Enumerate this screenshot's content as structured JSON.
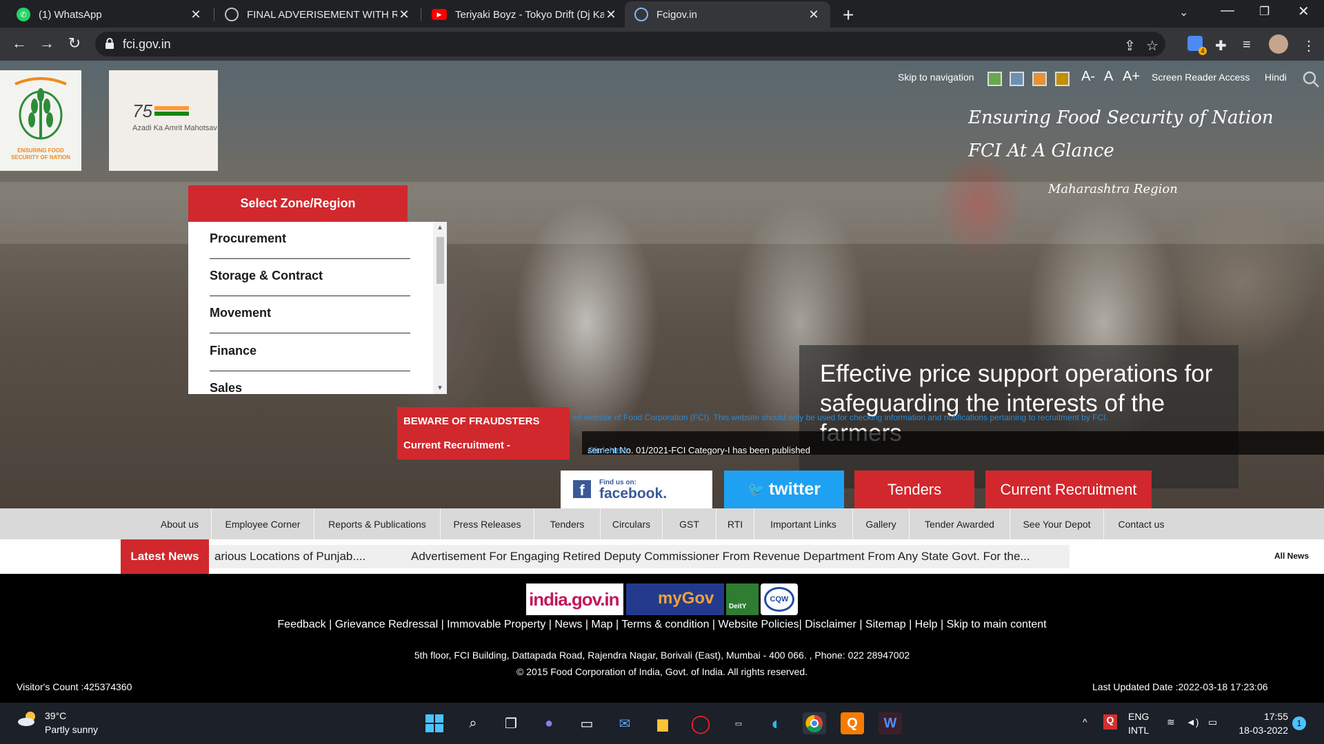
{
  "browser": {
    "tabs": [
      {
        "label": "(1) WhatsApp",
        "icon": "whatsapp-icon"
      },
      {
        "label": "FINAL ADVERISEMENT WITH REV",
        "icon": "globe-icon"
      },
      {
        "label": "Teriyaki Boyz - Tokyo Drift (Dj Kar",
        "icon": "youtube-icon"
      },
      {
        "label": "Fcigov.in",
        "icon": "fci-icon"
      }
    ],
    "url": "fci.gov.in"
  },
  "header": {
    "logo_text": "ENSURING FOOD SECURITY OF NATION",
    "logo2_number": "75",
    "logo2_text": "Azadi Ka Amrit Mahotsav",
    "skip_nav": "Skip to navigation",
    "font_small": "A-",
    "font_normal": "A",
    "font_large": "A+",
    "screen_reader": "Screen Reader Access",
    "language": "Hindi",
    "tagline1": "Ensuring Food Security of Nation",
    "tagline2": "FCI At A Glance",
    "tagline3": "Maharashtra Region",
    "swatch_colors": [
      "#6aa84f",
      "#6d8fb3",
      "#e69138",
      "#bf9000"
    ]
  },
  "zone": {
    "title": "Select Zone/Region",
    "items": [
      "Procurement",
      "Storage & Contract",
      "Movement",
      "Finance",
      "Sales"
    ]
  },
  "caption": {
    "text": "Effective price support operations for safeguarding the interests of the farmers"
  },
  "alerts": {
    "beware": "BEWARE OF FRAUDSTERS",
    "current": "Current Recruitment -",
    "marquee1": "ed website of Food Corporation (FCI). This website should only be used for checking information and notifications pertaining to recruitment by FCI.",
    "marquee2": "sement No. 01/2021-FCI Category-I has been published",
    "click_here": "Click Here"
  },
  "social": {
    "fb_small": "Find us on:",
    "fb_big": "facebook.",
    "twitter": "twitter",
    "tenders": "Tenders",
    "recruitment": "Current Recruitment"
  },
  "nav": [
    "About us",
    "Employee Corner",
    "Reports & Publications",
    "Press Releases",
    "Tenders",
    "Circulars",
    "GST",
    "RTI",
    "Important Links",
    "Gallery",
    "Tender Awarded",
    "See Your Depot",
    "Contact us"
  ],
  "news": {
    "label": "Latest News",
    "item1": "arious Locations of Punjab....",
    "item2": "Advertisement For Engaging Retired Deputy Commissioner From Revenue Department From Any State Govt. For the...",
    "all": "All News"
  },
  "footer": {
    "badges": [
      "india.gov.in",
      "myGov",
      "DeitY",
      "CQW"
    ],
    "links": "Feedback | Grievance Redressal | Immovable Property | News | Map | Terms & condition | Website Policies| Disclaimer | Sitemap | Help | Skip to main content",
    "address": "5th floor, FCI Building, Dattapada Road, Rajendra Nagar, Borivali (East), Mumbai - 400 066. , Phone: 022 28947002",
    "copyright": "© 2015 Food Corporation of India, Govt. of India. All rights reserved.",
    "visitors": "Visitor's Count :425374360",
    "updated": "Last Updated Date :2022-03-18 17:23:06"
  },
  "taskbar": {
    "temp": "39°C",
    "weather": "Partly sunny",
    "lang1": "ENG",
    "lang2": "INTL",
    "time": "17:55",
    "date": "18-03-2022",
    "notif": "1"
  }
}
